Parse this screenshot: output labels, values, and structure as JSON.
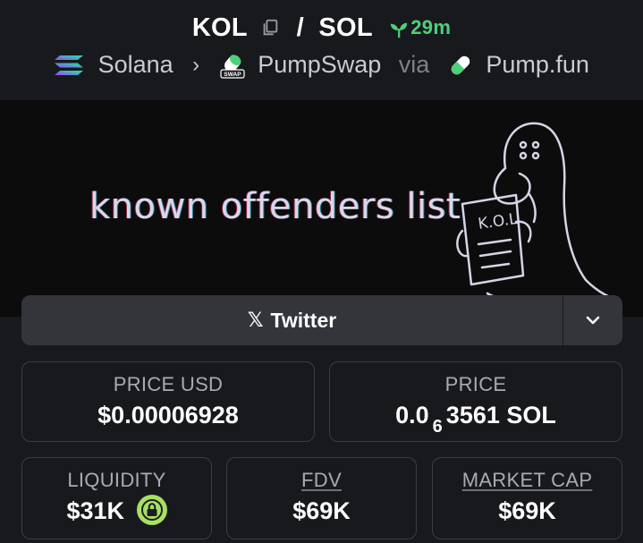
{
  "header": {
    "token_symbol": "KOL",
    "separator": "/",
    "quote_symbol": "SOL",
    "age": "29m",
    "chain": "Solana",
    "dex": "PumpSwap",
    "dex_badge": "SWAP",
    "via": "via",
    "launchpad": "Pump.fun"
  },
  "banner": {
    "text": "known offenders list",
    "sign_text": "K.O.L"
  },
  "links": {
    "twitter_label": "Twitter",
    "twitter_icon": "x-icon"
  },
  "stats": {
    "price_usd_label": "PRICE USD",
    "price_usd_value": "$0.00006928",
    "price_label": "PRICE",
    "price_prefix": "0.0",
    "price_zeros": "6",
    "price_suffix": "3561 SOL",
    "liquidity_label": "LIQUIDITY",
    "liquidity_value": "$31K",
    "fdv_label": "FDV",
    "fdv_value": "$69K",
    "mcap_label": "MARKET CAP",
    "mcap_value": "$69K"
  },
  "colors": {
    "background": "#18191d",
    "age_green": "#4ed07a",
    "lock_green": "#a8e063",
    "button_bg": "#34353b"
  }
}
